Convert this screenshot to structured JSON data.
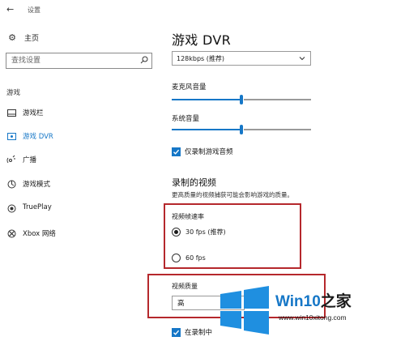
{
  "window": {
    "back_icon": "back-arrow-icon",
    "title": "设置"
  },
  "sidebar": {
    "home": {
      "label": "主页",
      "icon": "gear-icon"
    },
    "search": {
      "placeholder": "查找设置",
      "icon": "search-icon"
    },
    "section_label": "游戏",
    "items": [
      {
        "label": "游戏栏",
        "icon": "game-bar-icon",
        "active": false
      },
      {
        "label": "游戏 DVR",
        "icon": "game-dvr-icon",
        "active": true
      },
      {
        "label": "广播",
        "icon": "broadcast-icon",
        "active": false
      },
      {
        "label": "游戏模式",
        "icon": "game-mode-icon",
        "active": false
      },
      {
        "label": "TruePlay",
        "icon": "trueplay-icon",
        "active": false
      },
      {
        "label": "Xbox 网络",
        "icon": "xbox-icon",
        "active": false
      }
    ]
  },
  "main": {
    "title": "游戏 DVR",
    "audio_quality_value": "128kbps (推荐)",
    "mic_volume": {
      "label": "麦克风音量",
      "level_fraction": 0.5
    },
    "system_volume": {
      "label": "系统音量",
      "level_fraction": 0.5
    },
    "game_audio_only": {
      "label": "仅录制游戏音频",
      "checked": true
    },
    "recorded_video": {
      "heading": "录制的视频",
      "description": "更高质量的视频捕获可能会影响游戏的质量。"
    },
    "frame_rate": {
      "label": "视频帧速率",
      "options": [
        {
          "label": "30 fps (推荐)",
          "selected": true
        },
        {
          "label": "60 fps",
          "selected": false
        }
      ]
    },
    "video_quality": {
      "label": "视频质量",
      "value": "高"
    },
    "capture_cursor": {
      "label": "在录制中",
      "checked": true
    }
  },
  "colors": {
    "accent": "#1677c7",
    "annotation": "#b5282c"
  },
  "watermark": {
    "logo": "windows-logo",
    "title_latin": "Win10",
    "title_cjk": "之家",
    "url": "www.win10xitong.com"
  }
}
